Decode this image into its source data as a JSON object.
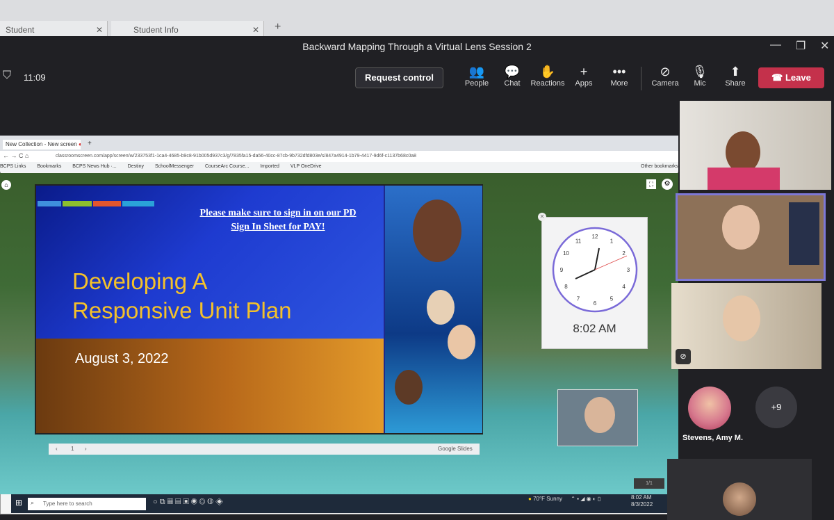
{
  "browser_tabs": [
    {
      "label": "Student"
    },
    {
      "label": "Student Info"
    }
  ],
  "window": {
    "title": "Backward Mapping Through a Virtual Lens Session 2"
  },
  "toolbar": {
    "time": "11:09",
    "request_control": "Request control",
    "buttons": [
      {
        "label": "People",
        "icon": "people-icon"
      },
      {
        "label": "Chat",
        "icon": "chat-icon"
      },
      {
        "label": "Reactions",
        "icon": "reactions-icon"
      },
      {
        "label": "Apps",
        "icon": "plus-icon"
      },
      {
        "label": "More",
        "icon": "more-icon"
      },
      {
        "label": "Camera",
        "icon": "camera-off-icon"
      },
      {
        "label": "Mic",
        "icon": "mic-off-icon"
      },
      {
        "label": "Share",
        "icon": "share-icon"
      }
    ],
    "leave": "Leave"
  },
  "shared_screen": {
    "chrome_tab": "New Collection - New screen",
    "url": "classroomscreen.com/app/screen/w/233753f1-1ca4-4685-b9c8-91b005d937c3/g/7835fa15-da56-40cc-87cb-9b732dfd803e/s/847a4914-1b79-4417-9d6f-c1137b68c0a8",
    "bookmarks": [
      "BCPS Links",
      "Bookmarks",
      "BCPS News Hub ·...",
      "Destiny",
      "SchoolMessenger",
      "CourseArc Course...",
      "Imported",
      "VLP OneDrive",
      "Other bookmarks"
    ],
    "slide": {
      "notice_line1": "Please make sure to  sign in on our PD",
      "notice_line2": "Sign In Sheet for PAY!",
      "title_line1": "Developing A",
      "title_line2": "Responsive Unit Plan",
      "date": "August 3, 2022",
      "page": "1",
      "provider": "Google Slides",
      "stripe_colors": [
        "#3f8fdc",
        "#8dbe2e",
        "#e2562e",
        "#2aa2d8"
      ]
    },
    "clock": {
      "time": "8:02 AM",
      "hour_numbers": [
        "12",
        "1",
        "2",
        "3",
        "4",
        "5",
        "6",
        "7",
        "8",
        "9",
        "10",
        "11"
      ]
    },
    "pager": "1/1",
    "taskbar": {
      "search": "Type here to search",
      "weather": "70°F  Sunny",
      "time": "8:02 AM",
      "date": "8/3/2022"
    }
  },
  "participants": {
    "named": "Stevens, Amy M.",
    "more": "+9"
  }
}
